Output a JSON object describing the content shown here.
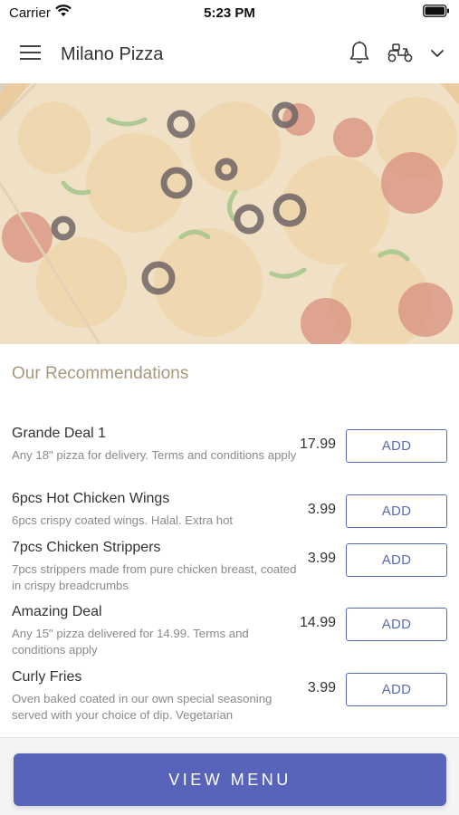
{
  "status_bar": {
    "carrier": "Carrier",
    "time": "5:23 PM"
  },
  "header": {
    "title": "Milano Pizza",
    "icons": [
      "menu-icon",
      "bell-icon",
      "scooter-icon",
      "chevron-down-icon"
    ]
  },
  "hero": {
    "image": "pizza-photo"
  },
  "recommendations": {
    "title": "Our Recommendations",
    "add_label": "ADD",
    "items": [
      {
        "name": "Grande Deal 1",
        "description": "Any 18\" pizza for delivery. Terms and conditions apply",
        "price": "17.99"
      },
      {
        "name": "6pcs Hot Chicken Wings",
        "description": "6pcs crispy coated wings. Halal. Extra hot",
        "price": "3.99"
      },
      {
        "name": "7pcs Chicken Strippers",
        "description": "7pcs strippers made from pure chicken breast, coated in crispy breadcrumbs",
        "price": "3.99"
      },
      {
        "name": "Amazing Deal",
        "description": "Any 15\" pizza delivered for 14.99. Terms and conditions apply",
        "price": "14.99"
      },
      {
        "name": "Curly Fries",
        "description": "Oven baked coated in our own special seasoning served with your choice of dip. Vegetarian",
        "price": "3.99"
      }
    ]
  },
  "footer": {
    "view_menu_label": "VIEW MENU"
  },
  "colors": {
    "accent": "#5764b9",
    "section_title": "#a8997c",
    "description": "#8a8a8a"
  }
}
